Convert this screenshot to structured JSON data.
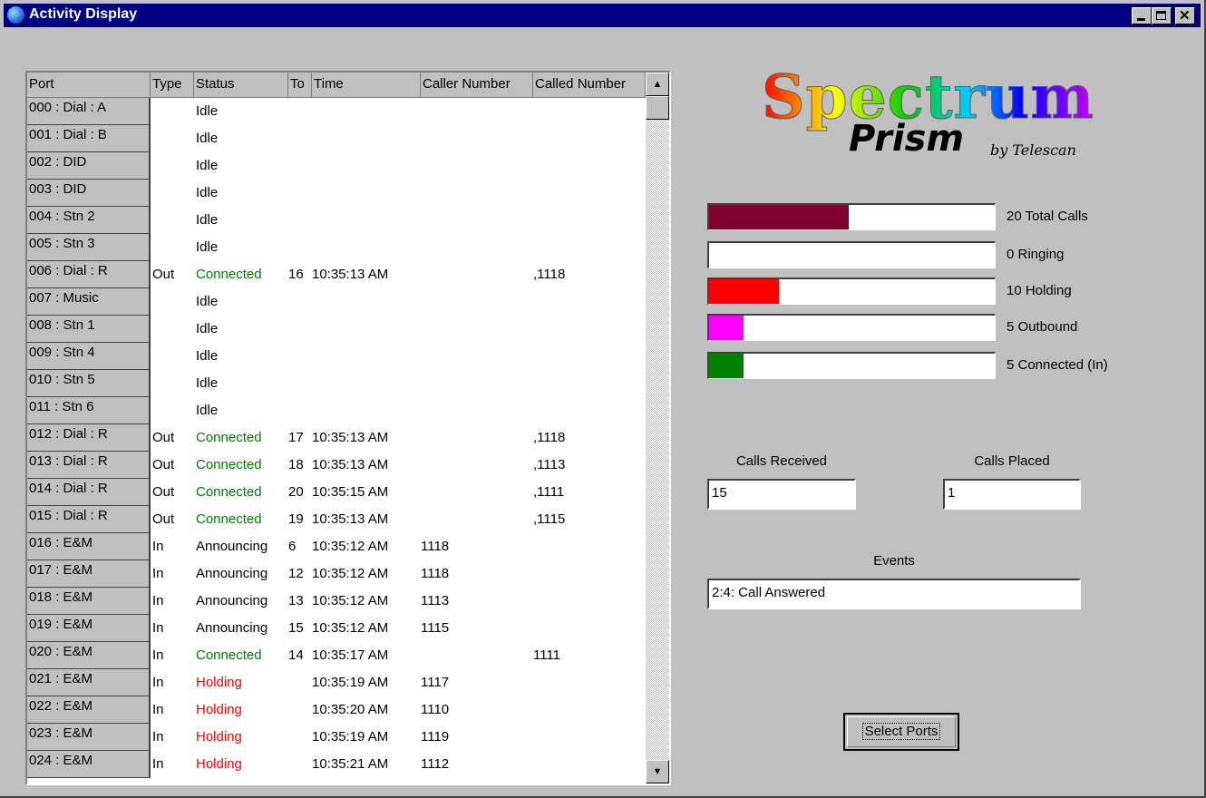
{
  "window": {
    "title": "Activity Display"
  },
  "grid": {
    "columns": [
      "Port",
      "Type",
      "Status",
      "To",
      "Time",
      "Caller Number",
      "Called Number"
    ],
    "rows": [
      {
        "port": "000 : Dial : A",
        "type": "",
        "status": "Idle",
        "to": "",
        "time": "",
        "caller": "",
        "called": "",
        "color": ""
      },
      {
        "port": "001 : Dial : B",
        "type": "",
        "status": "Idle",
        "to": "",
        "time": "",
        "caller": "",
        "called": "",
        "color": ""
      },
      {
        "port": "002 : DID",
        "type": "",
        "status": "Idle",
        "to": "",
        "time": "",
        "caller": "",
        "called": "",
        "color": ""
      },
      {
        "port": "003 : DID",
        "type": "",
        "status": "Idle",
        "to": "",
        "time": "",
        "caller": "",
        "called": "",
        "color": ""
      },
      {
        "port": "004 : Stn 2",
        "type": "",
        "status": "Idle",
        "to": "",
        "time": "",
        "caller": "",
        "called": "",
        "color": ""
      },
      {
        "port": "005 : Stn 3",
        "type": "",
        "status": "Idle",
        "to": "",
        "time": "",
        "caller": "",
        "called": "",
        "color": ""
      },
      {
        "port": "006 : Dial : R",
        "type": "Out",
        "status": "Connected",
        "to": "16",
        "time": "10:35:13 AM",
        "caller": "",
        "called": ",1118",
        "color": "green"
      },
      {
        "port": "007 : Music",
        "type": "",
        "status": "Idle",
        "to": "",
        "time": "",
        "caller": "",
        "called": "",
        "color": ""
      },
      {
        "port": "008 : Stn 1",
        "type": "",
        "status": "Idle",
        "to": "",
        "time": "",
        "caller": "",
        "called": "",
        "color": ""
      },
      {
        "port": "009 : Stn 4",
        "type": "",
        "status": "Idle",
        "to": "",
        "time": "",
        "caller": "",
        "called": "",
        "color": ""
      },
      {
        "port": "010 : Stn 5",
        "type": "",
        "status": "Idle",
        "to": "",
        "time": "",
        "caller": "",
        "called": "",
        "color": ""
      },
      {
        "port": "011 : Stn 6",
        "type": "",
        "status": "Idle",
        "to": "",
        "time": "",
        "caller": "",
        "called": "",
        "color": ""
      },
      {
        "port": "012 : Dial : R",
        "type": "Out",
        "status": "Connected",
        "to": "17",
        "time": "10:35:13 AM",
        "caller": "",
        "called": ",1118",
        "color": "green"
      },
      {
        "port": "013 : Dial : R",
        "type": "Out",
        "status": "Connected",
        "to": "18",
        "time": "10:35:13 AM",
        "caller": "",
        "called": ",1113",
        "color": "green"
      },
      {
        "port": "014 : Dial : R",
        "type": "Out",
        "status": "Connected",
        "to": "20",
        "time": "10:35:15 AM",
        "caller": "",
        "called": ",1111",
        "color": "green"
      },
      {
        "port": "015 : Dial : R",
        "type": "Out",
        "status": "Connected",
        "to": "19",
        "time": "10:35:13 AM",
        "caller": "",
        "called": ",1115",
        "color": "green"
      },
      {
        "port": "016 : E&M",
        "type": "In",
        "status": "Announcing",
        "to": "6",
        "time": "10:35:12 AM",
        "caller": "1118",
        "called": "",
        "color": ""
      },
      {
        "port": "017 : E&M",
        "type": "In",
        "status": "Announcing",
        "to": "12",
        "time": "10:35:12 AM",
        "caller": "1118",
        "called": "",
        "color": ""
      },
      {
        "port": "018 : E&M",
        "type": "In",
        "status": "Announcing",
        "to": "13",
        "time": "10:35:12 AM",
        "caller": "1113",
        "called": "",
        "color": ""
      },
      {
        "port": "019 : E&M",
        "type": "In",
        "status": "Announcing",
        "to": "15",
        "time": "10:35:12 AM",
        "caller": "1115",
        "called": "",
        "color": ""
      },
      {
        "port": "020 : E&M",
        "type": "In",
        "status": "Connected",
        "to": "14",
        "time": "10:35:17 AM",
        "caller": "",
        "called": "1111",
        "color": "green"
      },
      {
        "port": "021 : E&M",
        "type": "In",
        "status": "Holding",
        "to": "",
        "time": "10:35:19 AM",
        "caller": "1117",
        "called": "",
        "color": "red"
      },
      {
        "port": "022 : E&M",
        "type": "In",
        "status": "Holding",
        "to": "",
        "time": "10:35:20 AM",
        "caller": "1110",
        "called": "",
        "color": "red"
      },
      {
        "port": "023 : E&M",
        "type": "In",
        "status": "Holding",
        "to": "",
        "time": "10:35:19 AM",
        "caller": "1119",
        "called": "",
        "color": "red"
      },
      {
        "port": "024 : E&M",
        "type": "In",
        "status": "Holding",
        "to": "",
        "time": "10:35:21 AM",
        "caller": "1112",
        "called": "",
        "color": "red"
      }
    ]
  },
  "logo": {
    "title": "Spectrum",
    "subtitle": "Prism",
    "byline": "by Telescan"
  },
  "stats": [
    {
      "key": "total",
      "label": "20 Total Calls",
      "fraction": 0.49,
      "color": "#800030"
    },
    {
      "key": "ringing",
      "label": "0 Ringing",
      "fraction": 0.0,
      "color": "#ff0000"
    },
    {
      "key": "holding",
      "label": "10 Holding",
      "fraction": 0.245,
      "color": "#ff0000"
    },
    {
      "key": "outbound",
      "label": "5 Outbound",
      "fraction": 0.12,
      "color": "#ff00ff"
    },
    {
      "key": "connected",
      "label": "5 Connected (In)",
      "fraction": 0.12,
      "color": "#008000"
    }
  ],
  "counters": {
    "received_label": "Calls Received",
    "received_value": "15",
    "placed_label": "Calls Placed",
    "placed_value": "1",
    "events_label": "Events",
    "events_value": "2:4: Call Answered"
  },
  "buttons": {
    "select_ports": "Select Ports"
  },
  "colors": {
    "titlebar": "#000080",
    "connected": "#008000",
    "holding": "#ff0000"
  }
}
